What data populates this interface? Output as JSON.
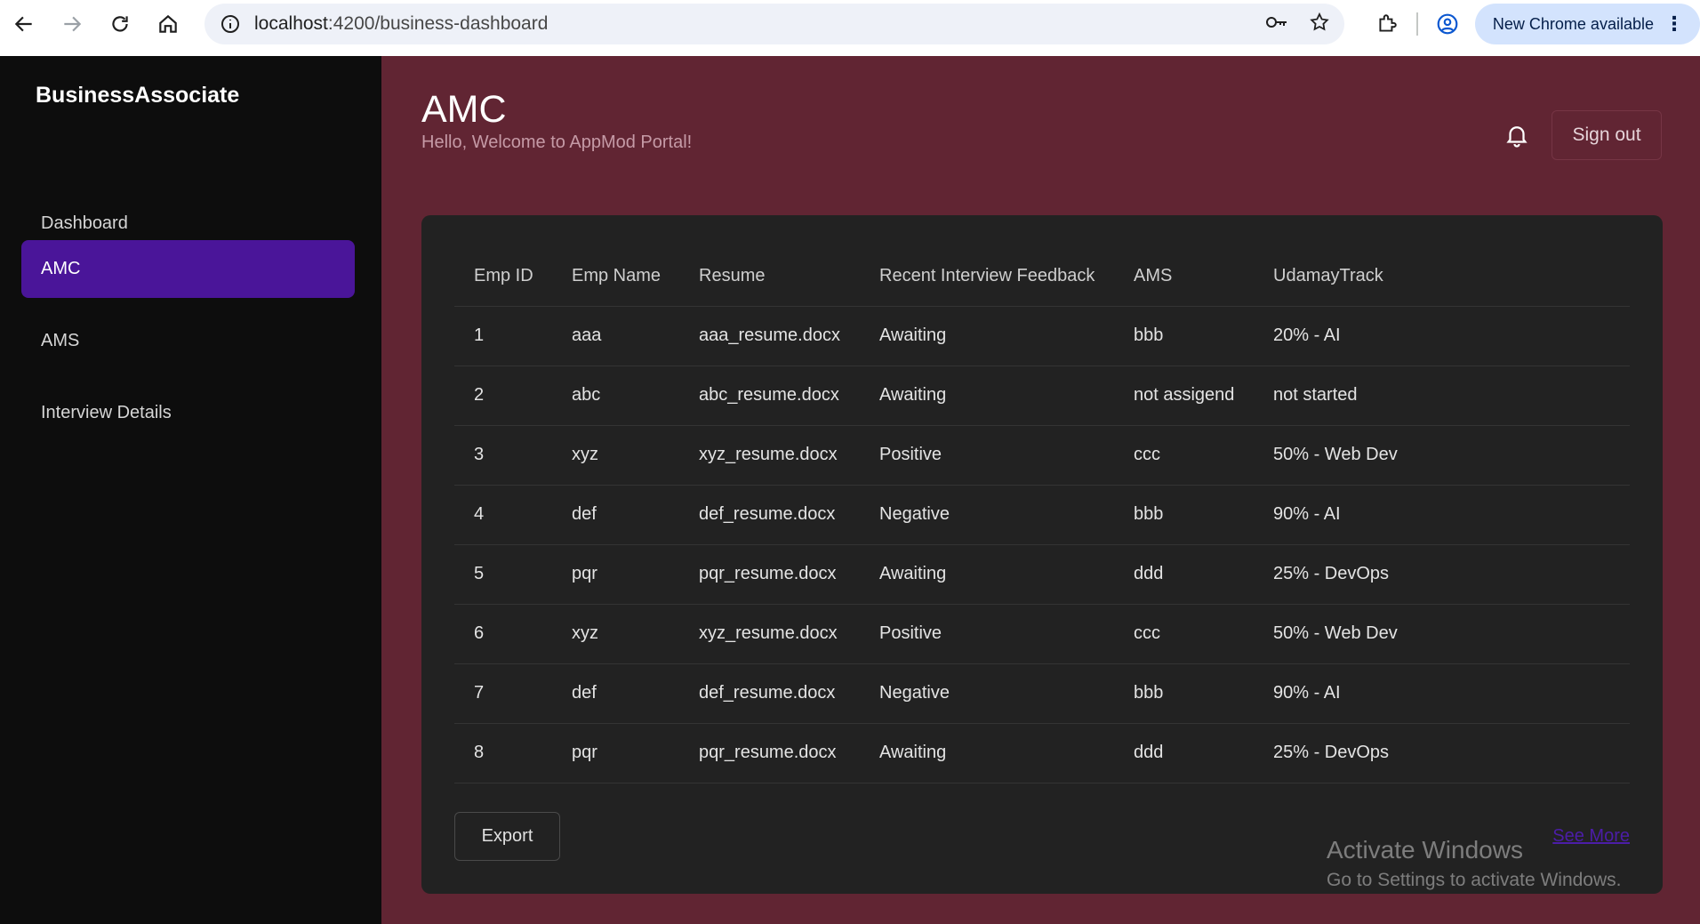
{
  "browser": {
    "url_host": "localhost",
    "url_path": ":4200/business-dashboard",
    "new_chrome_label": "New Chrome available"
  },
  "sidebar": {
    "brand": "BusinessAssociate",
    "items": [
      {
        "label": "Dashboard"
      },
      {
        "label": "AMC"
      },
      {
        "label": "AMS"
      },
      {
        "label": "Interview Details"
      }
    ]
  },
  "header": {
    "title": "AMC",
    "subtitle": "Hello, Welcome to AppMod Portal!",
    "signout_label": "Sign out"
  },
  "table": {
    "columns": [
      "Emp ID",
      "Emp Name",
      "Resume",
      "Recent Interview Feedback",
      "AMS",
      "UdamayTrack"
    ],
    "rows": [
      [
        "1",
        "aaa",
        "aaa_resume.docx",
        "Awaiting",
        "bbb",
        "20% - AI"
      ],
      [
        "2",
        "abc",
        "abc_resume.docx",
        "Awaiting",
        "not assigend",
        "not started"
      ],
      [
        "3",
        "xyz",
        "xyz_resume.docx",
        "Positive",
        "ccc",
        "50% - Web Dev"
      ],
      [
        "4",
        "def",
        "def_resume.docx",
        "Negative",
        "bbb",
        "90% - AI"
      ],
      [
        "5",
        "pqr",
        "pqr_resume.docx",
        "Awaiting",
        "ddd",
        "25% - DevOps"
      ],
      [
        "6",
        "xyz",
        "xyz_resume.docx",
        "Positive",
        "ccc",
        "50% - Web Dev"
      ],
      [
        "7",
        "def",
        "def_resume.docx",
        "Negative",
        "bbb",
        "90% - AI"
      ],
      [
        "8",
        "pqr",
        "pqr_resume.docx",
        "Awaiting",
        "ddd",
        "25% - DevOps"
      ]
    ]
  },
  "footer": {
    "export_label": "Export",
    "see_more_label": "See More"
  },
  "watermark": {
    "line1": "Activate Windows",
    "line2": "Go to Settings to activate Windows."
  },
  "colors": {
    "sidebar_bg": "#0d0d0d",
    "main_bg": "#612533",
    "card_bg": "#222222",
    "active_item": "#4a1599",
    "link": "#4c1da8"
  }
}
